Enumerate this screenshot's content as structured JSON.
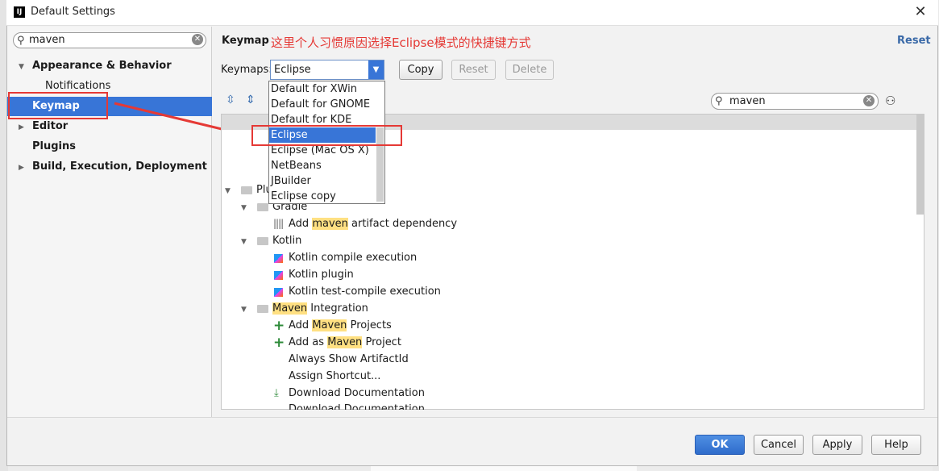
{
  "window": {
    "title": "Default Settings",
    "app_icon": "intellij-icon"
  },
  "sidebar": {
    "search_value": "maven",
    "items": [
      {
        "label": "Appearance & Behavior"
      },
      {
        "label": "Notifications"
      },
      {
        "label": "Keymap"
      },
      {
        "label": "Editor"
      },
      {
        "label": "Plugins"
      },
      {
        "label": "Build, Execution, Deployment"
      }
    ]
  },
  "main": {
    "title": "Keymap",
    "annotation": "这里个人习惯原因选择Eclipse模式的快捷键方式",
    "reset_link": "Reset",
    "keymaps_label": "Keymaps:",
    "keymaps_value": "Eclipse",
    "copy_button": "Copy",
    "reset_button": "Reset",
    "delete_button": "Delete",
    "search_value": "maven",
    "dropdown_options": [
      "Default for XWin",
      "Default for GNOME",
      "Default for KDE",
      "Eclipse",
      "Eclipse (Mac OS X)",
      "NetBeans",
      "JBuilder",
      "Eclipse copy"
    ],
    "tree": {
      "plugins_partial": "Plu",
      "gradle": "Gradle",
      "add_prefix": "Add",
      "maven_lower": "maven",
      "artifact_suffix": "artifact dependency",
      "kotlin": "Kotlin",
      "kotlin_items": [
        "Kotlin compile execution",
        "Kotlin plugin",
        "Kotlin test-compile execution"
      ],
      "maven_word": "Maven",
      "integration_suffix": "Integration",
      "add_as_prefix": "Add as",
      "projects_suffix": "Projects",
      "project_suffix": "Project",
      "always_show": "Always Show ArtifactId",
      "assign_shortcut": "Assign Shortcut...",
      "download_docs": "Download Documentation"
    }
  },
  "footer": {
    "ok": "OK",
    "cancel": "Cancel",
    "apply": "Apply",
    "help": "Help"
  },
  "colors": {
    "selection": "#3875d7",
    "annotation": "#e53935",
    "highlight": "#ffe082"
  }
}
